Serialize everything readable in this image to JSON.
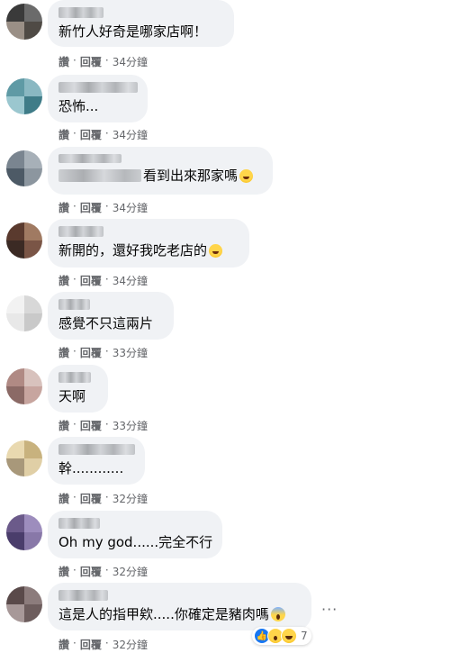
{
  "actions": {
    "like_label": "讚",
    "dot": "·",
    "reply_label": "回覆"
  },
  "comments": [
    {
      "text": "新竹人好奇是哪家店啊！",
      "time": "34分鐘"
    },
    {
      "text": "恐怖...",
      "time": "34分鐘"
    },
    {
      "text": "看到出來那家嗎",
      "time": "34分鐘",
      "emoji": "rolling-laugh"
    },
    {
      "text": "新開的，還好我吃老店的",
      "time": "34分鐘",
      "emoji": "rolling-laugh"
    },
    {
      "text": "感覺不只這兩片",
      "time": "33分鐘"
    },
    {
      "text": "天啊",
      "time": "33分鐘"
    },
    {
      "text": "幹............",
      "time": "32分鐘"
    },
    {
      "text": "Oh my god......完全不行",
      "time": "32分鐘"
    },
    {
      "text": "這是人的指甲欸.....你確定是豬肉嗎",
      "time": "32分鐘",
      "emoji": "screaming-face",
      "reactions": {
        "icons": [
          "like",
          "wow",
          "haha"
        ],
        "count": "7"
      }
    }
  ],
  "more_options": "···"
}
